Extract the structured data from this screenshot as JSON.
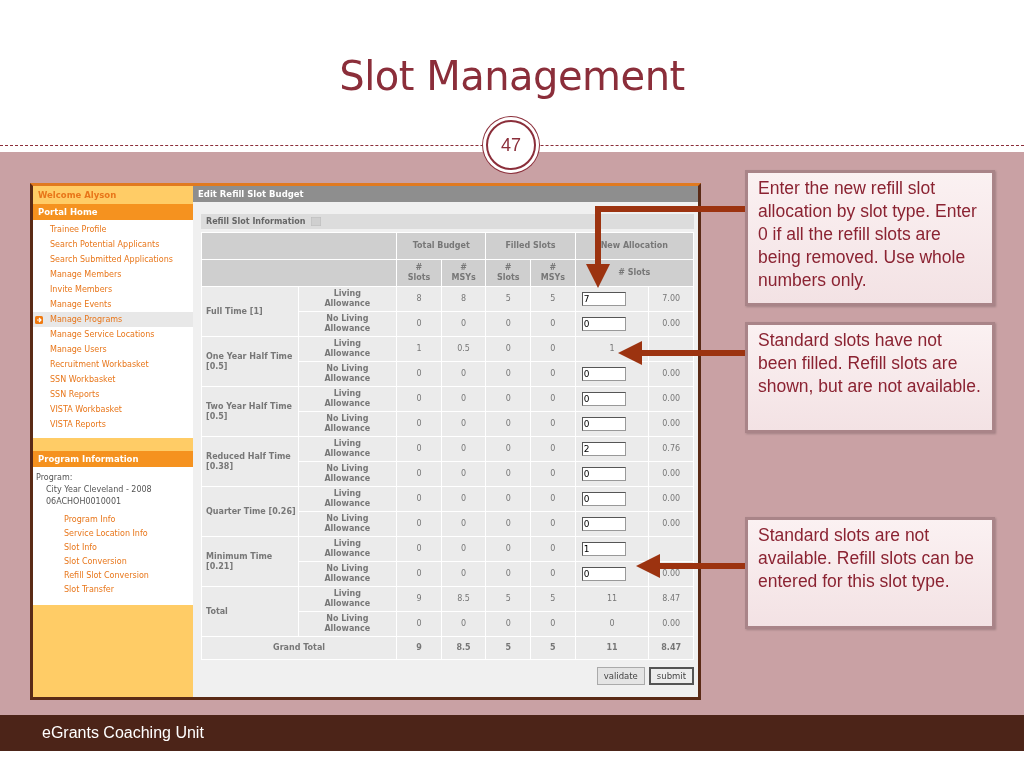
{
  "slide": {
    "title": "Slot Management",
    "page_number": "47",
    "footer": "eGrants Coaching Unit"
  },
  "sidebar": {
    "welcome": "Welcome Alyson",
    "portal_heading": "Portal Home",
    "items": [
      {
        "label": "Trainee Profile",
        "selected": false
      },
      {
        "label": "Search Potential Applicants",
        "selected": false
      },
      {
        "label": "Search Submitted Applications",
        "selected": false
      },
      {
        "label": "Manage Members",
        "selected": false
      },
      {
        "label": "Invite Members",
        "selected": false
      },
      {
        "label": "Manage Events",
        "selected": false
      },
      {
        "label": "Manage Programs",
        "selected": true
      },
      {
        "label": "Manage Service Locations",
        "selected": false
      },
      {
        "label": "Manage Users",
        "selected": false
      },
      {
        "label": "Recruitment Workbasket",
        "selected": false
      },
      {
        "label": "SSN Workbasket",
        "selected": false
      },
      {
        "label": "SSN Reports",
        "selected": false
      },
      {
        "label": "VISTA Workbasket",
        "selected": false
      },
      {
        "label": "VISTA Reports",
        "selected": false
      }
    ],
    "program_heading": "Program Information",
    "program_label": "Program:",
    "program_name": "City Year Cleveland - 2008",
    "program_id": "06ACHOH0010001",
    "program_links": [
      "Program Info",
      "Service Location Info",
      "Slot Info",
      "Slot Conversion",
      "Refill Slot Conversion",
      "Slot Transfer"
    ]
  },
  "main": {
    "title": "Edit Refill Slot Budget",
    "section": "Refill Slot Information",
    "table": {
      "group_headers": [
        "Total Budget",
        "Filled Slots",
        "New Allocation"
      ],
      "sub_headers": [
        "# Slots",
        "# MSYs",
        "# Slots",
        "# MSYs",
        "# Slots"
      ],
      "groups": [
        {
          "label": "Full Time [1]",
          "rows": [
            {
              "type": "Living Allowance",
              "values": [
                "8",
                "8",
                "5",
                "5"
              ],
              "new_slots": {
                "kind": "input",
                "value": "7"
              },
              "new_msys": "7.00"
            },
            {
              "type": "No Living Allowance",
              "values": [
                "0",
                "0",
                "0",
                "0"
              ],
              "new_slots": {
                "kind": "input",
                "value": "0"
              },
              "new_msys": "0.00"
            }
          ]
        },
        {
          "label": "One Year Half Time [0.5]",
          "rows": [
            {
              "type": "Living Allowance",
              "values": [
                "1",
                "0.5",
                "0",
                "0"
              ],
              "new_slots": {
                "kind": "text",
                "value": "1"
              }
            },
            {
              "type": "No Living Allowance",
              "values": [
                "0",
                "0",
                "0",
                "0"
              ],
              "new_slots": {
                "kind": "input",
                "value": "0"
              },
              "new_msys": "0.00"
            }
          ]
        },
        {
          "label": "Two Year Half Time [0.5]",
          "rows": [
            {
              "type": "Living Allowance",
              "values": [
                "0",
                "0",
                "0",
                "0"
              ],
              "new_slots": {
                "kind": "input",
                "value": "0"
              },
              "new_msys": "0.00"
            },
            {
              "type": "No Living Allowance",
              "values": [
                "0",
                "0",
                "0",
                "0"
              ],
              "new_slots": {
                "kind": "input",
                "value": "0"
              },
              "new_msys": "0.00"
            }
          ]
        },
        {
          "label": "Reduced Half Time [0.38]",
          "rows": [
            {
              "type": "Living Allowance",
              "values": [
                "0",
                "0",
                "0",
                "0"
              ],
              "new_slots": {
                "kind": "input",
                "value": "2"
              },
              "new_msys": "0.76"
            },
            {
              "type": "No Living Allowance",
              "values": [
                "0",
                "0",
                "0",
                "0"
              ],
              "new_slots": {
                "kind": "input",
                "value": "0"
              },
              "new_msys": "0.00"
            }
          ]
        },
        {
          "label": "Quarter Time [0.26]",
          "rows": [
            {
              "type": "Living Allowance",
              "values": [
                "0",
                "0",
                "0",
                "0"
              ],
              "new_slots": {
                "kind": "input",
                "value": "0"
              },
              "new_msys": "0.00"
            },
            {
              "type": "No Living Allowance",
              "values": [
                "0",
                "0",
                "0",
                "0"
              ],
              "new_slots": {
                "kind": "input",
                "value": "0"
              },
              "new_msys": "0.00"
            }
          ]
        },
        {
          "label": "Minimum Time [0.21]",
          "rows": [
            {
              "type": "Living Allowance",
              "values": [
                "0",
                "0",
                "0",
                "0"
              ],
              "new_slots": {
                "kind": "input",
                "value": "1"
              }
            },
            {
              "type": "No Living Allowance",
              "values": [
                "0",
                "0",
                "0",
                "0"
              ],
              "new_slots": {
                "kind": "input",
                "value": "0"
              },
              "new_msys": "0.00"
            }
          ]
        },
        {
          "label": "Total",
          "rows": [
            {
              "type": "Living Allowance",
              "values": [
                "9",
                "8.5",
                "5",
                "5"
              ],
              "new_slots": {
                "kind": "text",
                "value": "11"
              },
              "new_msys": "8.47"
            },
            {
              "type": "No Living Allowance",
              "values": [
                "0",
                "0",
                "0",
                "0"
              ],
              "new_slots": {
                "kind": "text",
                "value": "0"
              },
              "new_msys": "0.00"
            }
          ]
        }
      ],
      "grand_total": {
        "label": "Grand Total",
        "values": [
          "9",
          "8.5",
          "5",
          "5",
          "11",
          "8.47"
        ]
      }
    },
    "buttons": [
      "validate",
      "submit"
    ]
  },
  "callouts": [
    {
      "text": "Enter the new refill slot allocation by slot type. Enter 0 if all the refill slots are being removed. Use whole numbers only."
    },
    {
      "text": "Standard slots have not been filled. Refill slots are shown, but are not available."
    },
    {
      "text": "Standard slots are not available. Refill slots can be entered for this slot type."
    }
  ]
}
